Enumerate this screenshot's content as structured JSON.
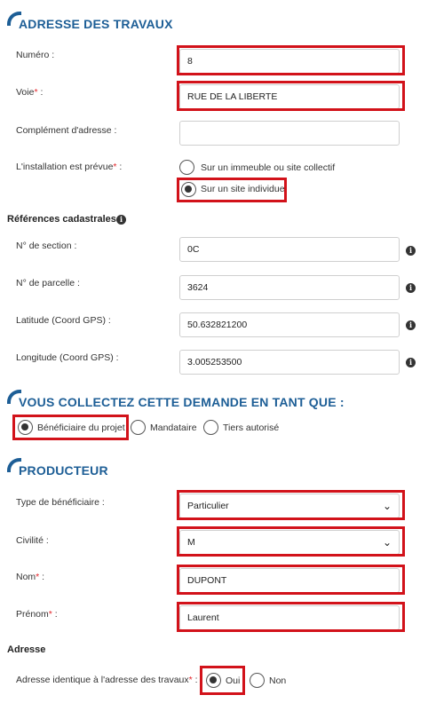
{
  "travaux": {
    "title": "ADRESSE DES TRAVAUX",
    "numero": {
      "label": "Numéro :",
      "value": "8"
    },
    "voie": {
      "label": "Voie",
      "required_mark": "*",
      "suffix": " :",
      "value": "RUE DE LA LIBERTE"
    },
    "complement": {
      "label": "Complément d'adresse :",
      "value": ""
    },
    "installation": {
      "label": "L'installation est prévue",
      "required_mark": "*",
      "suffix": " :",
      "options": [
        {
          "label": "Sur un immeuble ou site collectif",
          "checked": false
        },
        {
          "label": "Sur un site individuel",
          "checked": true
        }
      ]
    }
  },
  "cadastre": {
    "title": "Références cadastrales",
    "info_icon": "i",
    "section": {
      "label": "N° de section :",
      "value": "0C"
    },
    "parcelle": {
      "label": "N° de parcelle :",
      "value": "3624"
    },
    "latitude": {
      "label": "Latitude (Coord GPS) :",
      "value": "50.632821200"
    },
    "longitude": {
      "label": "Longitude (Coord GPS) :",
      "value": "3.005253500"
    }
  },
  "collecte": {
    "title": "VOUS COLLECTEZ CETTE DEMANDE EN TANT QUE :",
    "options": [
      {
        "label": "Bénéficiaire du projet",
        "checked": true
      },
      {
        "label": "Mandataire",
        "checked": false
      },
      {
        "label": "Tiers autorisé",
        "checked": false
      }
    ]
  },
  "producteur": {
    "title": "PRODUCTEUR",
    "type": {
      "label": "Type de bénéficiaire :",
      "value": "Particulier"
    },
    "civilite": {
      "label": "Civilité :",
      "value": "M"
    },
    "nom": {
      "label": "Nom",
      "required_mark": "*",
      "suffix": " :",
      "value": "DUPONT"
    },
    "prenom": {
      "label": "Prénom",
      "required_mark": "*",
      "suffix": " :",
      "value": "Laurent"
    },
    "adresse_heading": "Adresse",
    "adresse_identique": {
      "label": "Adresse identique à l'adresse des travaux",
      "required_mark": "*",
      "suffix": " :",
      "options": [
        {
          "label": "Oui",
          "checked": true
        },
        {
          "label": "Non",
          "checked": false
        }
      ]
    }
  },
  "colors": {
    "accent": "#1d5e96",
    "highlight": "#d2121a",
    "required": "#e3262b"
  },
  "icons": {
    "select_arrow": "chevron-down-icon",
    "info": "info-icon"
  }
}
